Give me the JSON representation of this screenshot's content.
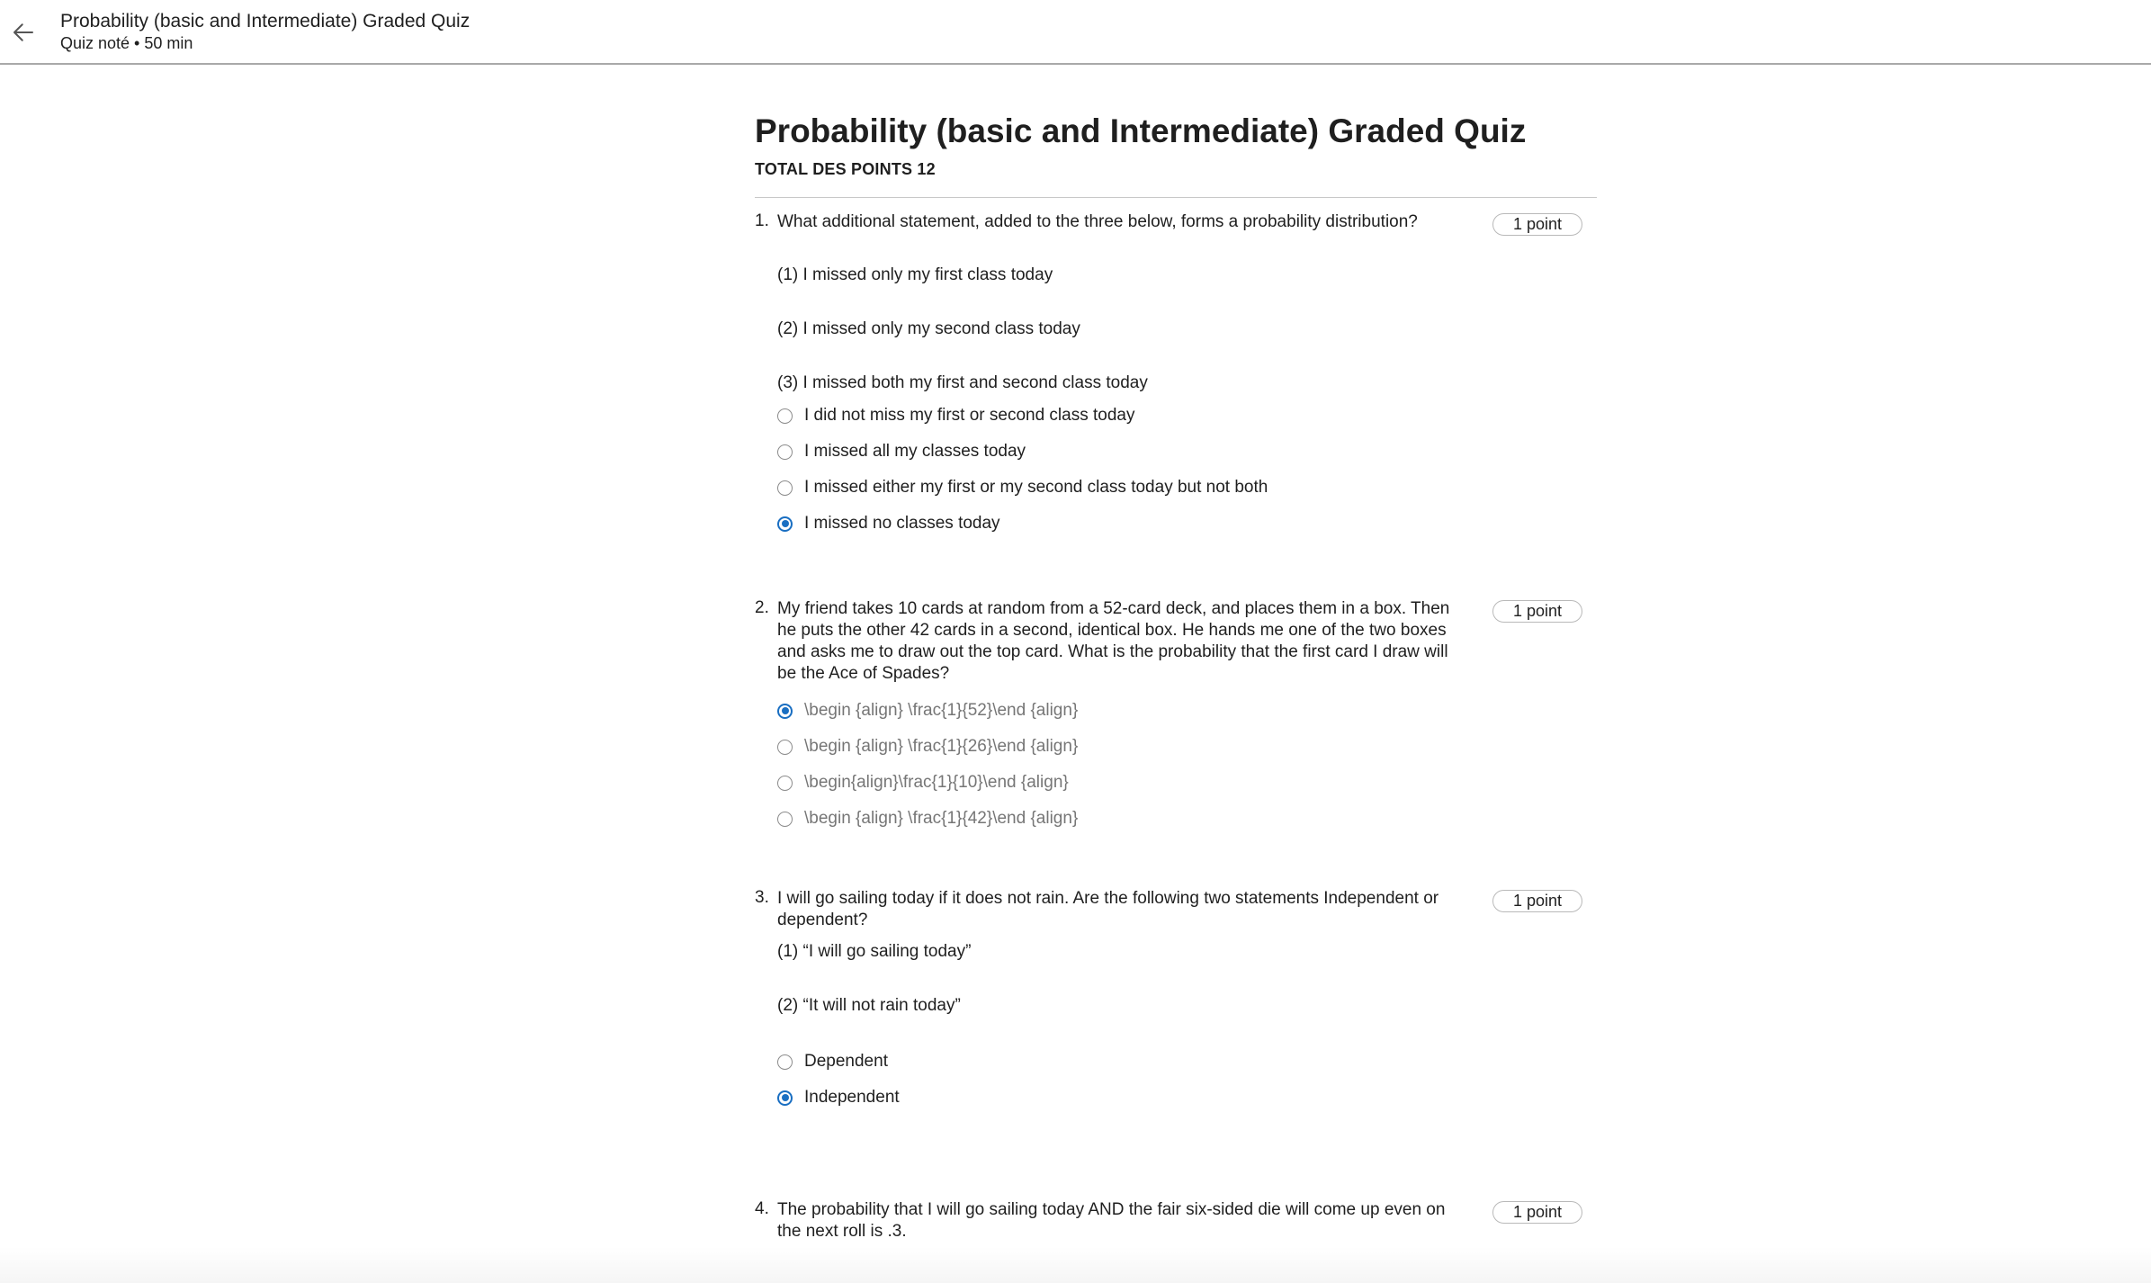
{
  "header": {
    "title": "Probability (basic and Intermediate) Graded Quiz",
    "subtitle": "Quiz noté • 50  min"
  },
  "quiz": {
    "title": "Probability (basic and Intermediate) Graded Quiz",
    "total_points": "TOTAL DES POINTS 12"
  },
  "questions": [
    {
      "number": "1.",
      "text": "What additional statement, added to the three below, forms a probability distribution?",
      "points": "1 point",
      "statements": [
        "(1) I missed only my first class today",
        "(2) I missed only my second class today",
        "(3) I missed both my first and second class today"
      ],
      "options": [
        {
          "label": "I did not miss my first or second class today",
          "selected": false
        },
        {
          "label": "I missed all my classes today",
          "selected": false
        },
        {
          "label": "I missed either my first or my second class today but not both",
          "selected": false
        },
        {
          "label": "I missed no classes today",
          "selected": true
        }
      ]
    },
    {
      "number": "2.",
      "text": "My friend takes 10 cards at random from a 52-card deck, and places them in a box. Then he puts the other 42 cards in a second, identical box. He hands me one of the two boxes and asks me to draw out the top card. What is the probability that the first card I draw will be the Ace of Spades?",
      "points": "1 point",
      "options": [
        {
          "label": "\\begin {align} \\frac{1}{52}\\end {align}",
          "selected": true
        },
        {
          "label": "\\begin {align} \\frac{1}{26}\\end {align}",
          "selected": false
        },
        {
          "label": "\\begin{align}\\frac{1}{10}\\end {align}",
          "selected": false
        },
        {
          "label": "\\begin {align} \\frac{1}{42}\\end {align}",
          "selected": false
        }
      ]
    },
    {
      "number": "3.",
      "text": "I will go sailing today if it does not rain. Are the following two statements Independent or dependent?",
      "points": "1 point",
      "statements": [
        "(1) “I will go sailing today”",
        "(2) “It will not rain today”"
      ],
      "options": [
        {
          "label": "Dependent",
          "selected": false
        },
        {
          "label": "Independent",
          "selected": true
        }
      ]
    },
    {
      "number": "4.",
      "text": "The probability that I will go sailing today AND the fair six-sided die will come up even on the next roll is .3.",
      "points": "1 point"
    }
  ],
  "icons": {
    "back": "arrow-left-icon",
    "radio": "radio-button"
  },
  "colors": {
    "accent": "#1a6fc2",
    "divider": "#a9a9a9"
  }
}
